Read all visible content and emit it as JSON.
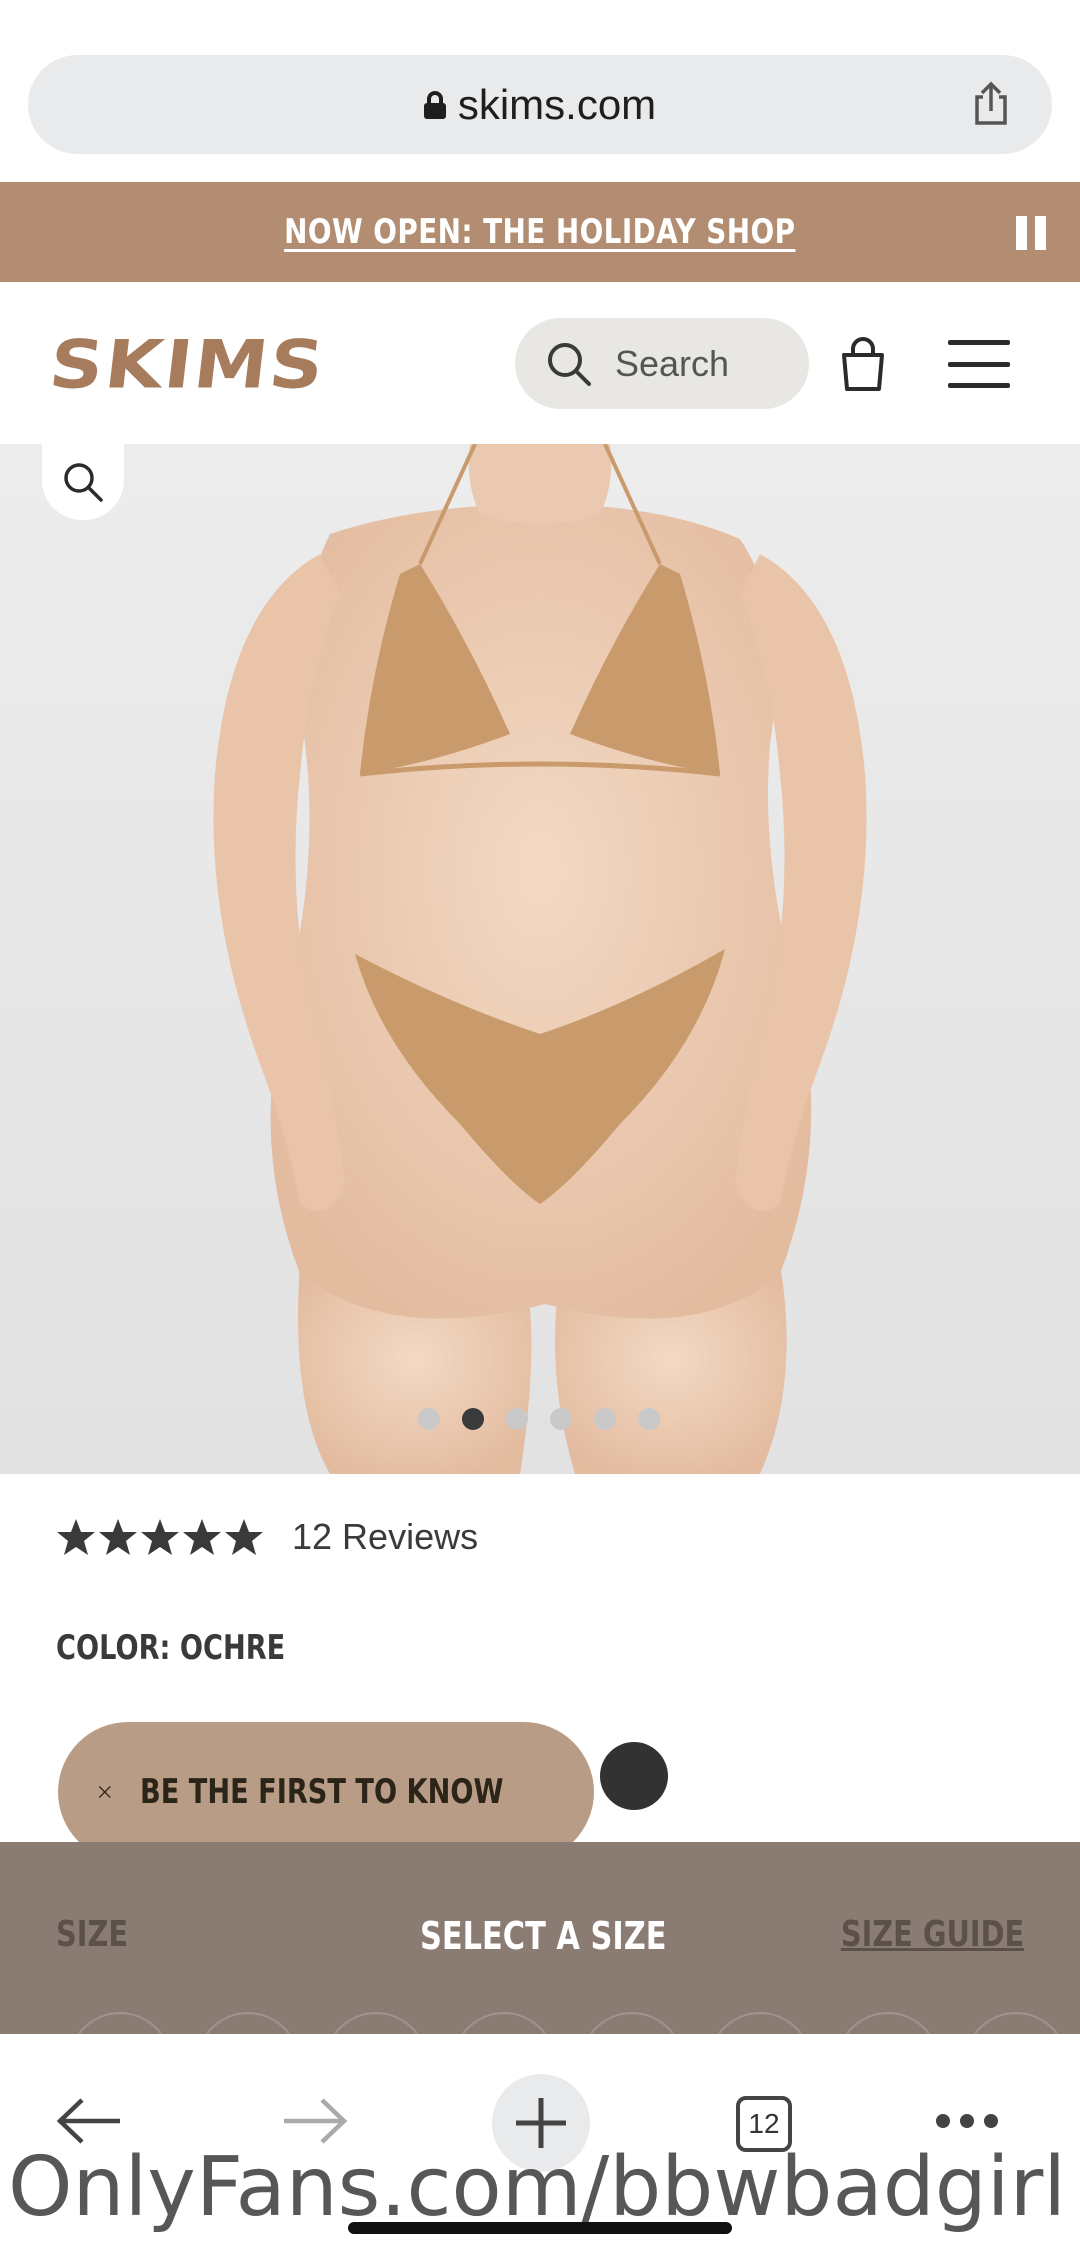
{
  "browser": {
    "url": "skims.com",
    "tab_count": "12"
  },
  "promo": {
    "text": "NOW OPEN: THE HOLIDAY SHOP"
  },
  "header": {
    "logo": "SKIMS",
    "search_placeholder": "Search"
  },
  "product": {
    "rating": 5,
    "reviews_text": "12 Reviews",
    "color_label": "COLOR: OCHRE",
    "carousel": {
      "total": 6,
      "active_index": 1
    },
    "swatch_color": "#323232"
  },
  "notify": {
    "text": "BE THE FIRST TO KNOW"
  },
  "sizebar": {
    "size_label": "SIZE",
    "select_label": "SELECT A SIZE",
    "guide_label": "SIZE GUIDE"
  },
  "watermark": "OnlyFans.com/bbwbadgirl",
  "colors": {
    "promo_bg": "#b28d71",
    "logo": "#a77c5d",
    "notify_bg": "#b89c86",
    "sizebar_bg": "#8a7c72"
  }
}
